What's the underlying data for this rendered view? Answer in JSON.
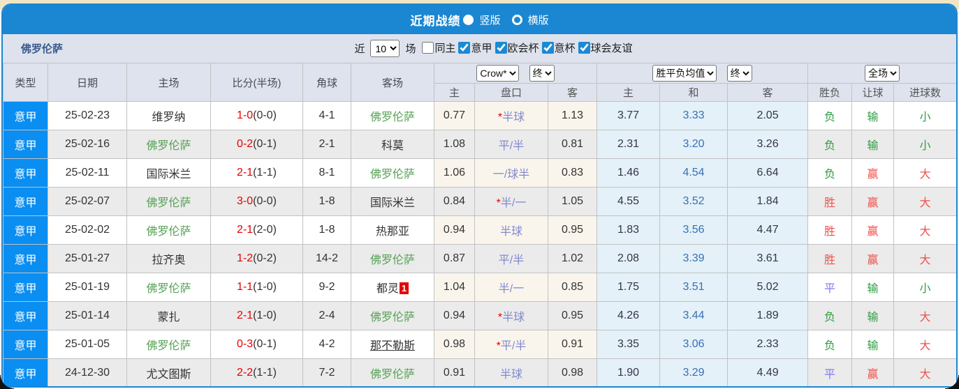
{
  "colors": {
    "topbar_bg": "#1b87d2",
    "league_bg": "#0a8ef2",
    "header_bg": "#dee3ee",
    "score_red": "#e80000",
    "status_red": "#f0504a",
    "status_green": "#2f9e43",
    "status_blue": "#7a7af2",
    "handicap_line_blue": "#8089ce",
    "draw_odds_blue": "#3a6fb5",
    "focus_team_green": "#56a156"
  },
  "titlebar": {
    "title": "近期战绩",
    "radio_vertical": "竖版",
    "radio_horizontal": "横版"
  },
  "filterbar": {
    "team": "佛罗伦萨",
    "recent_label": "近",
    "recent_value": "10",
    "matches_label": "场",
    "checkboxes": [
      {
        "label": "同主",
        "checked": false
      },
      {
        "label": "意甲",
        "checked": true
      },
      {
        "label": "欧会杯",
        "checked": true
      },
      {
        "label": "意杯",
        "checked": true
      },
      {
        "label": "球会友谊",
        "checked": true
      }
    ]
  },
  "table": {
    "headers": {
      "type": "类型",
      "date": "日期",
      "home": "主场",
      "score": "比分(半场)",
      "corner": "角球",
      "away": "客场",
      "asia_provider": "Crow*",
      "asia_state": "终",
      "asia_sub": [
        "主",
        "盘口",
        "客"
      ],
      "euro_provider": "胜平负均值",
      "euro_state": "终",
      "euro_sub": [
        "主",
        "和",
        "客"
      ],
      "result_scope": "全场",
      "result_sub": [
        "胜负",
        "让球",
        "进球数"
      ]
    },
    "rows": [
      {
        "league": "意甲",
        "date": "25-02-23",
        "home": {
          "name": "维罗纳",
          "focus": false
        },
        "score": {
          "ft": "1-0",
          "ht": "(0-0)"
        },
        "corners": "4-1",
        "away": {
          "name": "佛罗伦萨",
          "focus": true
        },
        "asia": {
          "home": "0.77",
          "star": true,
          "line": "半球",
          "away": "1.13"
        },
        "europe": {
          "home": "3.77",
          "draw": "3.33",
          "away": "2.05"
        },
        "outcome": {
          "text": "负",
          "color": "green"
        },
        "handicap": {
          "text": "输",
          "color": "green"
        },
        "goals": {
          "text": "小",
          "color": "green"
        }
      },
      {
        "league": "意甲",
        "date": "25-02-16",
        "home": {
          "name": "佛罗伦萨",
          "focus": true
        },
        "score": {
          "ft": "0-2",
          "ht": "(0-1)"
        },
        "corners": "2-1",
        "away": {
          "name": "科莫",
          "focus": false
        },
        "asia": {
          "home": "1.08",
          "star": false,
          "line": "平/半",
          "away": "0.81"
        },
        "europe": {
          "home": "2.31",
          "draw": "3.20",
          "away": "3.26"
        },
        "outcome": {
          "text": "负",
          "color": "green"
        },
        "handicap": {
          "text": "输",
          "color": "green"
        },
        "goals": {
          "text": "小",
          "color": "green"
        }
      },
      {
        "league": "意甲",
        "date": "25-02-11",
        "home": {
          "name": "国际米兰",
          "focus": false
        },
        "score": {
          "ft": "2-1",
          "ht": "(1-1)"
        },
        "corners": "8-1",
        "away": {
          "name": "佛罗伦萨",
          "focus": true
        },
        "asia": {
          "home": "1.06",
          "star": false,
          "line": "一/球半",
          "away": "0.83"
        },
        "europe": {
          "home": "1.46",
          "draw": "4.54",
          "away": "6.64"
        },
        "outcome": {
          "text": "负",
          "color": "green"
        },
        "handicap": {
          "text": "赢",
          "color": "red"
        },
        "goals": {
          "text": "大",
          "color": "red"
        }
      },
      {
        "league": "意甲",
        "date": "25-02-07",
        "home": {
          "name": "佛罗伦萨",
          "focus": true
        },
        "score": {
          "ft": "3-0",
          "ht": "(0-0)"
        },
        "corners": "1-8",
        "away": {
          "name": "国际米兰",
          "focus": false
        },
        "asia": {
          "home": "0.84",
          "star": true,
          "line": "半/一",
          "away": "1.05"
        },
        "europe": {
          "home": "4.55",
          "draw": "3.52",
          "away": "1.84"
        },
        "outcome": {
          "text": "胜",
          "color": "red"
        },
        "handicap": {
          "text": "赢",
          "color": "red"
        },
        "goals": {
          "text": "大",
          "color": "red"
        }
      },
      {
        "league": "意甲",
        "date": "25-02-02",
        "home": {
          "name": "佛罗伦萨",
          "focus": true
        },
        "score": {
          "ft": "2-1",
          "ht": "(2-0)"
        },
        "corners": "1-8",
        "away": {
          "name": "热那亚",
          "focus": false
        },
        "asia": {
          "home": "0.94",
          "star": false,
          "line": "半球",
          "away": "0.95"
        },
        "europe": {
          "home": "1.83",
          "draw": "3.56",
          "away": "4.47"
        },
        "outcome": {
          "text": "胜",
          "color": "red"
        },
        "handicap": {
          "text": "赢",
          "color": "red"
        },
        "goals": {
          "text": "大",
          "color": "red"
        }
      },
      {
        "league": "意甲",
        "date": "25-01-27",
        "home": {
          "name": "拉齐奥",
          "focus": false
        },
        "score": {
          "ft": "1-2",
          "ht": "(0-2)"
        },
        "corners": "14-2",
        "away": {
          "name": "佛罗伦萨",
          "focus": true
        },
        "asia": {
          "home": "0.87",
          "star": false,
          "line": "平/半",
          "away": "1.02"
        },
        "europe": {
          "home": "2.08",
          "draw": "3.39",
          "away": "3.61"
        },
        "outcome": {
          "text": "胜",
          "color": "red"
        },
        "handicap": {
          "text": "赢",
          "color": "red"
        },
        "goals": {
          "text": "大",
          "color": "red"
        }
      },
      {
        "league": "意甲",
        "date": "25-01-19",
        "home": {
          "name": "佛罗伦萨",
          "focus": true
        },
        "score": {
          "ft": "1-1",
          "ht": "(1-0)"
        },
        "corners": "9-2",
        "away": {
          "name": "都灵",
          "focus": false,
          "badge": "1"
        },
        "asia": {
          "home": "1.04",
          "star": false,
          "line": "半/一",
          "away": "0.85"
        },
        "europe": {
          "home": "1.75",
          "draw": "3.51",
          "away": "5.02"
        },
        "outcome": {
          "text": "平",
          "color": "blue"
        },
        "handicap": {
          "text": "输",
          "color": "green"
        },
        "goals": {
          "text": "小",
          "color": "green"
        }
      },
      {
        "league": "意甲",
        "date": "25-01-14",
        "home": {
          "name": "蒙扎",
          "focus": false
        },
        "score": {
          "ft": "2-1",
          "ht": "(1-0)"
        },
        "corners": "2-4",
        "away": {
          "name": "佛罗伦萨",
          "focus": true
        },
        "asia": {
          "home": "0.94",
          "star": true,
          "line": "半球",
          "away": "0.95"
        },
        "europe": {
          "home": "4.26",
          "draw": "3.44",
          "away": "1.89"
        },
        "outcome": {
          "text": "负",
          "color": "green"
        },
        "handicap": {
          "text": "输",
          "color": "green"
        },
        "goals": {
          "text": "大",
          "color": "red"
        }
      },
      {
        "league": "意甲",
        "date": "25-01-05",
        "home": {
          "name": "佛罗伦萨",
          "focus": true
        },
        "score": {
          "ft": "0-3",
          "ht": "(0-1)"
        },
        "corners": "4-2",
        "away": {
          "name": "那不勒斯",
          "focus": false,
          "underline": true
        },
        "asia": {
          "home": "0.98",
          "star": true,
          "line": "平/半",
          "away": "0.91"
        },
        "europe": {
          "home": "3.35",
          "draw": "3.06",
          "away": "2.33"
        },
        "outcome": {
          "text": "负",
          "color": "green"
        },
        "handicap": {
          "text": "输",
          "color": "green"
        },
        "goals": {
          "text": "大",
          "color": "red"
        }
      },
      {
        "league": "意甲",
        "date": "24-12-30",
        "home": {
          "name": "尤文图斯",
          "focus": false
        },
        "score": {
          "ft": "2-2",
          "ht": "(1-1)"
        },
        "corners": "7-2",
        "away": {
          "name": "佛罗伦萨",
          "focus": true
        },
        "asia": {
          "home": "0.91",
          "star": false,
          "line": "半球",
          "away": "0.98"
        },
        "europe": {
          "home": "1.90",
          "draw": "3.29",
          "away": "4.49"
        },
        "outcome": {
          "text": "平",
          "color": "blue"
        },
        "handicap": {
          "text": "赢",
          "color": "red"
        },
        "goals": {
          "text": "大",
          "color": "red"
        }
      }
    ]
  }
}
